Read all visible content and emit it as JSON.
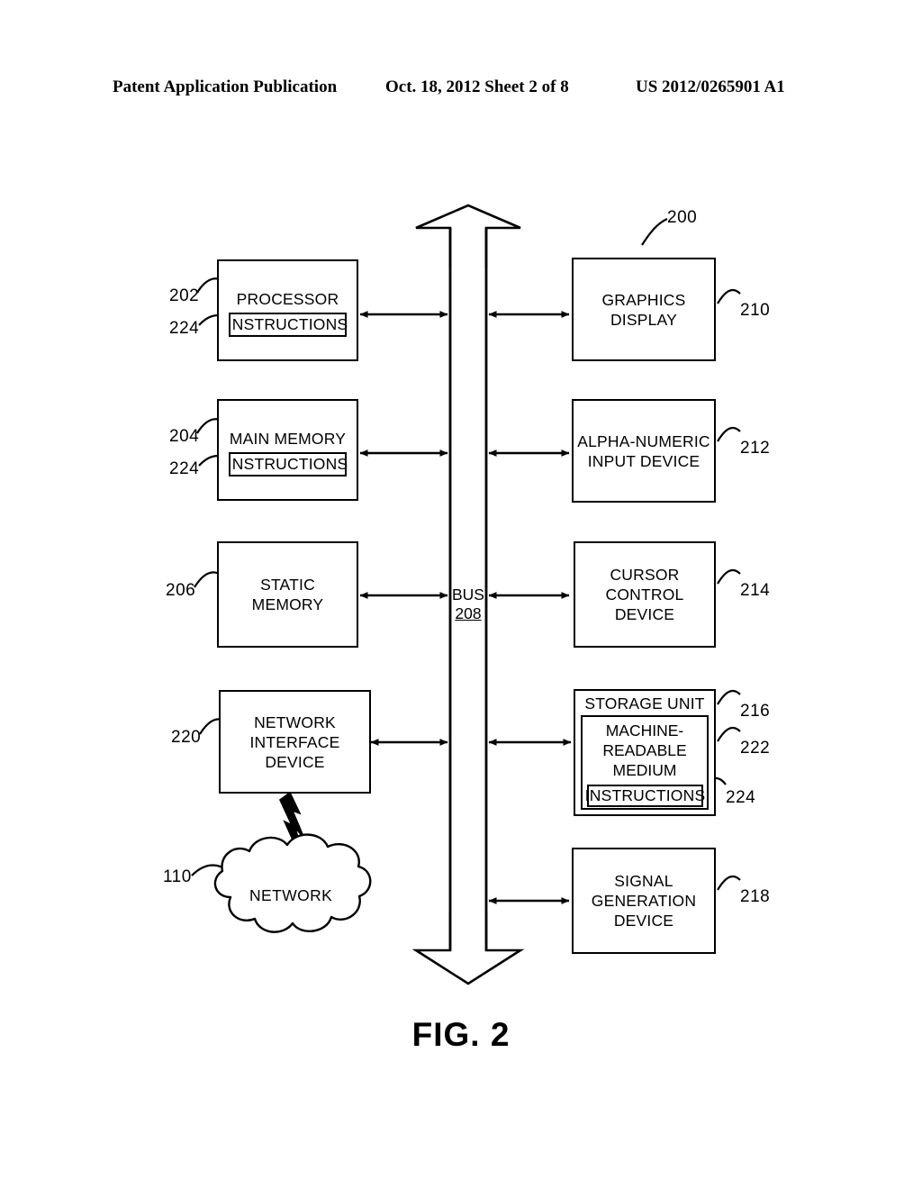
{
  "header": {
    "left": "Patent Application Publication",
    "middle": "Oct. 18, 2012  Sheet 2 of 8",
    "right": "US 2012/0265901 A1"
  },
  "figure": {
    "caption": "FIG. 2",
    "system_ref": "200",
    "bus": {
      "label": "BUS",
      "ref": "208"
    },
    "left_column": [
      {
        "id": "processor",
        "label": "PROCESSOR",
        "ref": "202",
        "inner": {
          "label": "INSTRUCTIONS",
          "ref": "224"
        }
      },
      {
        "id": "main-memory",
        "label": "MAIN MEMORY",
        "ref": "204",
        "inner": {
          "label": "INSTRUCTIONS",
          "ref": "224"
        }
      },
      {
        "id": "static-memory",
        "label": "STATIC\nMEMORY",
        "ref": "206"
      },
      {
        "id": "network-interface-device",
        "label": "NETWORK\nINTERFACE\nDEVICE",
        "ref": "220"
      }
    ],
    "right_column": [
      {
        "id": "graphics-display",
        "label": "GRAPHICS\nDISPLAY",
        "ref": "210"
      },
      {
        "id": "alpha-numeric-input-device",
        "label": "ALPHA-NUMERIC\nINPUT DEVICE",
        "ref": "212"
      },
      {
        "id": "cursor-control-device",
        "label": "CURSOR\nCONTROL\nDEVICE",
        "ref": "214"
      },
      {
        "id": "storage-unit",
        "label": "STORAGE UNIT",
        "ref": "216",
        "medium": {
          "label": "MACHINE-\nREADABLE\nMEDIUM",
          "ref": "222"
        },
        "instructions": {
          "label": "INSTRUCTIONS",
          "ref": "224"
        }
      },
      {
        "id": "signal-generation-device",
        "label": "SIGNAL\nGENERATION\nDEVICE",
        "ref": "218"
      }
    ],
    "network": {
      "id": "network-cloud",
      "label": "NETWORK",
      "ref": "110"
    }
  },
  "colors": {
    "ink": "#000000",
    "paper": "#ffffff"
  }
}
